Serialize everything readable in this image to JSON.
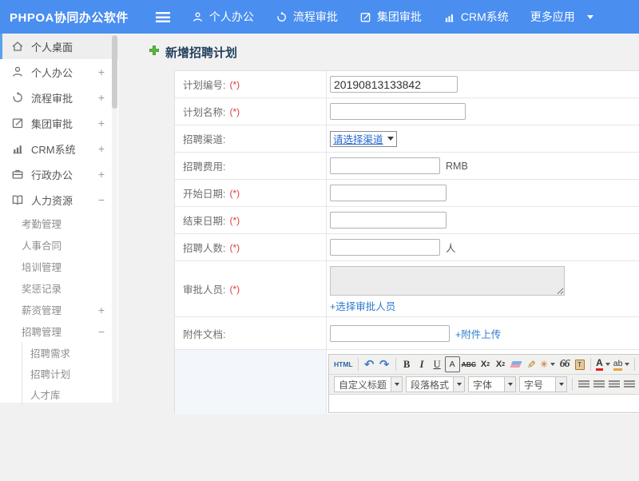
{
  "app": {
    "brand": "PHPOA协同办公软件"
  },
  "navbar": {
    "items": [
      {
        "label": "个人办公",
        "icon": "person-icon"
      },
      {
        "label": "流程审批",
        "icon": "flow-icon"
      },
      {
        "label": "集团审批",
        "icon": "edit-icon"
      },
      {
        "label": "CRM系统",
        "icon": "chart-icon"
      },
      {
        "label": "更多应用",
        "icon": "caret-down-icon"
      }
    ]
  },
  "sidebar": {
    "level1": [
      {
        "label": "个人桌面",
        "toggle": "",
        "icon": "home-icon",
        "active": true
      },
      {
        "label": "个人办公",
        "toggle": "+",
        "icon": "person-icon"
      },
      {
        "label": "流程审批",
        "toggle": "+",
        "icon": "flow-icon"
      },
      {
        "label": "集团审批",
        "toggle": "+",
        "icon": "edit-icon"
      },
      {
        "label": "CRM系统",
        "toggle": "+",
        "icon": "chart-icon"
      },
      {
        "label": "行政办公",
        "toggle": "+",
        "icon": "briefcase-icon"
      },
      {
        "label": "人力资源",
        "toggle": "−",
        "icon": "book-icon"
      }
    ],
    "level2": [
      {
        "label": "考勤管理",
        "toggle": ""
      },
      {
        "label": "人事合同",
        "toggle": ""
      },
      {
        "label": "培训管理",
        "toggle": ""
      },
      {
        "label": "奖惩记录",
        "toggle": ""
      },
      {
        "label": "薪资管理",
        "toggle": "+"
      },
      {
        "label": "招聘管理",
        "toggle": "−"
      }
    ],
    "level3": [
      {
        "label": "招聘需求"
      },
      {
        "label": "招聘计划"
      },
      {
        "label": "人才库"
      }
    ]
  },
  "page": {
    "title": "新增招聘计划"
  },
  "form": {
    "rows": [
      {
        "label": "计划编号:",
        "required": "(*)",
        "value": "20190813133842"
      },
      {
        "label": "计划名称:",
        "required": "(*)",
        "value": ""
      },
      {
        "label": "招聘渠道:",
        "required": "",
        "select_value": "请选择渠道"
      },
      {
        "label": "招聘费用:",
        "required": "",
        "value": "",
        "unit": "RMB"
      },
      {
        "label": "开始日期:",
        "required": "(*)",
        "value": ""
      },
      {
        "label": "结束日期:",
        "required": "(*)",
        "value": ""
      },
      {
        "label": "招聘人数:",
        "required": "(*)",
        "value": "",
        "unit": "人"
      },
      {
        "label": "审批人员:",
        "required": "(*)",
        "value": "",
        "link": "+选择审批人员"
      },
      {
        "label": "附件文档:",
        "required": "",
        "value": "",
        "link": "+附件上传"
      }
    ]
  },
  "editor": {
    "tb1": {
      "html": "HTML",
      "undo": "↶",
      "redo": "↷",
      "bold": "B",
      "italic": "I",
      "underline": "U",
      "boxed_a": "A",
      "strike": "ABC",
      "sup_base": "X",
      "sup_exp": "2",
      "sub_base": "X",
      "sub_exp": "2",
      "wand": "✳",
      "quote": "66",
      "paste": "T",
      "forecolor": "A",
      "hilite": "ab"
    },
    "combos": [
      {
        "label": "自定义标题"
      },
      {
        "label": "段落格式"
      },
      {
        "label": "字体"
      },
      {
        "label": "字号"
      }
    ],
    "link_glyph": "∞"
  },
  "colors": {
    "navbar_blue": "#4a8ef0",
    "active_border_blue": "#58a1ef",
    "title_navy": "#24425f",
    "link_blue": "#2e7cd0",
    "required_red": "#e03a3a",
    "plus_green": "#5cb544"
  }
}
